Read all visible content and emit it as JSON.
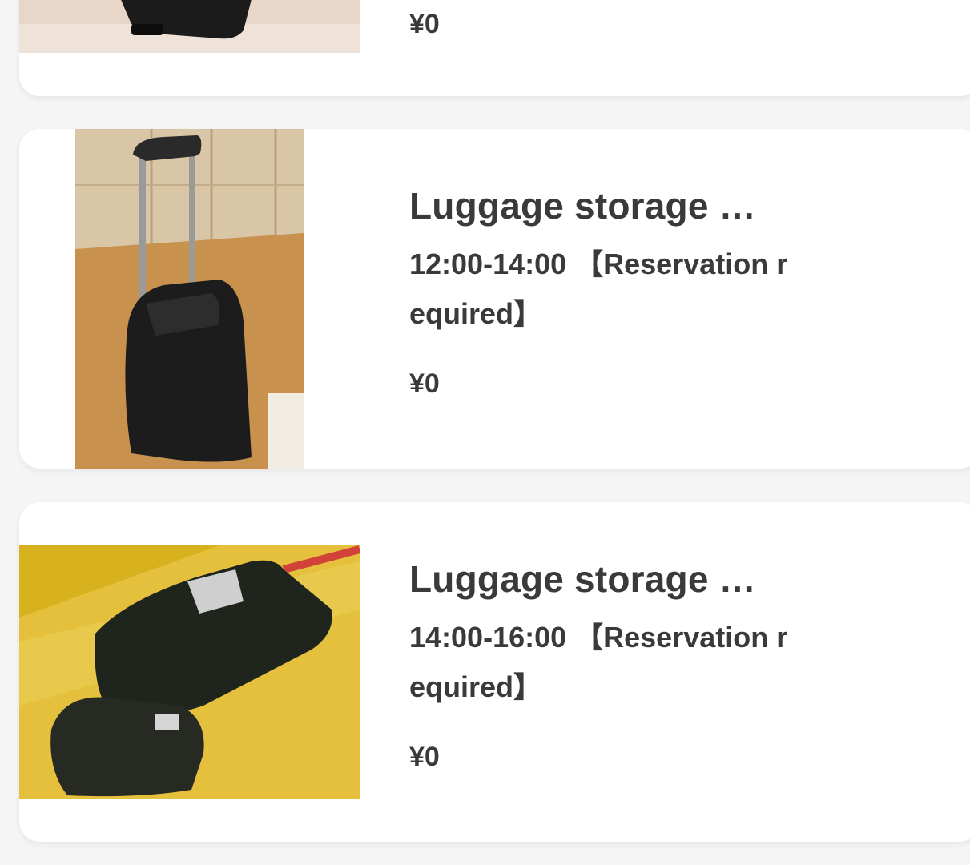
{
  "listings": [
    {
      "title": "",
      "time_text": "",
      "price": "¥0",
      "photo_icon": "suitcase-photo"
    },
    {
      "title": "Luggage storage …",
      "time_text": "12:00-14:00 【Reservation required】",
      "price": "¥0",
      "photo_icon": "rolling-suitcase-photo"
    },
    {
      "title": "Luggage storage …",
      "time_text": "14:00-16:00 【Reservation required】",
      "price": "¥0",
      "photo_icon": "black-bags-photo"
    }
  ]
}
